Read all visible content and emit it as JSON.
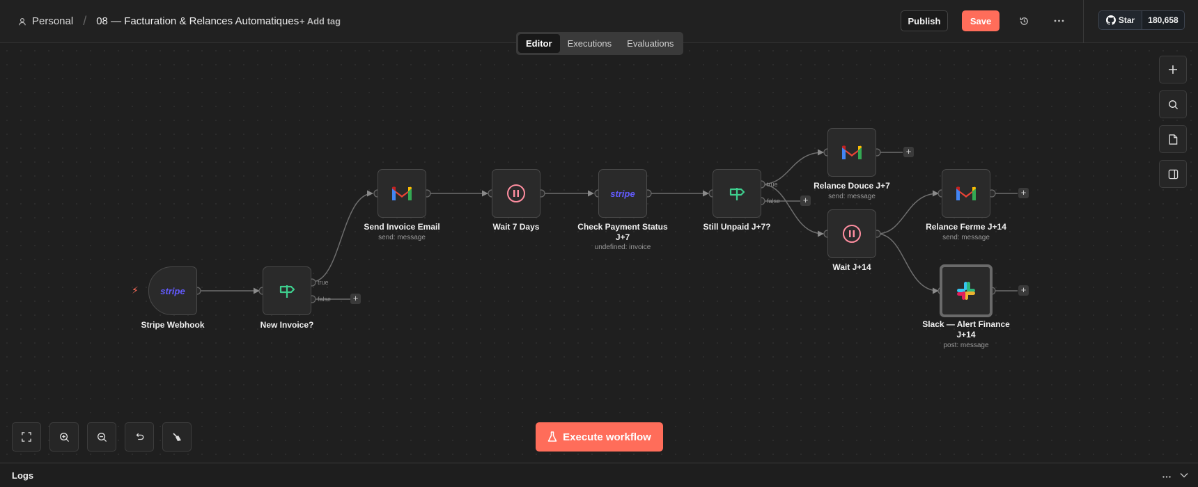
{
  "header": {
    "breadcrumb_root": "Personal",
    "separator": "/",
    "workflow_title": "08 — Facturation & Relances Automatiques",
    "add_tag": "+ Add tag",
    "publish": "Publish",
    "save": "Save",
    "github_star": "Star",
    "github_count": "180,658"
  },
  "tabs": [
    {
      "label": "Editor",
      "active": true
    },
    {
      "label": "Executions",
      "active": false
    },
    {
      "label": "Evaluations",
      "active": false
    }
  ],
  "nodes": {
    "stripe_webhook": {
      "label": "Stripe Webhook",
      "icon": "stripe-logo"
    },
    "new_invoice": {
      "label": "New Invoice?",
      "icon": "signpost-icon",
      "true": "true",
      "false": "false"
    },
    "send_invoice": {
      "label": "Send Invoice Email",
      "sub": "send: message",
      "icon": "gmail-logo"
    },
    "wait7": {
      "label": "Wait 7 Days",
      "icon": "pause-icon"
    },
    "check_payment": {
      "label": "Check Payment Status J+7",
      "sub": "undefined: invoice",
      "icon": "stripe-logo"
    },
    "still_unpaid": {
      "label": "Still Unpaid J+7?",
      "icon": "signpost-icon",
      "true": "true",
      "false": "false"
    },
    "relance_douce": {
      "label": "Relance Douce J+7",
      "sub": "send: message",
      "icon": "gmail-logo"
    },
    "wait14": {
      "label": "Wait J+14",
      "icon": "pause-icon"
    },
    "relance_ferme": {
      "label": "Relance Ferme J+14",
      "sub": "send: message",
      "icon": "gmail-logo"
    },
    "slack_alert": {
      "label": "Slack — Alert Finance J+14",
      "sub": "post: message",
      "icon": "slack-logo"
    }
  },
  "stripe_text": "stripe",
  "execute": "Execute workflow",
  "logs": {
    "title": "Logs"
  },
  "colors": {
    "accent": "#ff6d5a",
    "stripe": "#635bff",
    "ifgreen": "#3ecf8e",
    "wait": "#ff8ea0"
  }
}
